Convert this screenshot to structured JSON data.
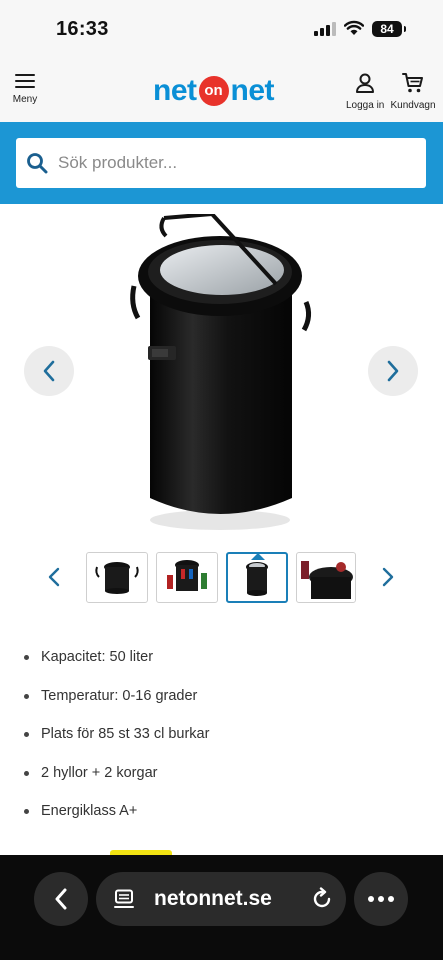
{
  "status_bar": {
    "time": "16:33",
    "battery": "84"
  },
  "header": {
    "menu_label": "Meny",
    "logo": {
      "left": "net",
      "middle": "on",
      "right": "net"
    },
    "login_label": "Logga in",
    "cart_label": "Kundvagn"
  },
  "search": {
    "placeholder": "Sök produkter..."
  },
  "specs": [
    "Kapacitet: 50 liter",
    "Temperatur: 0-16 grader",
    "Plats för 85 st 33 cl burkar",
    "2 hyllor + 2 korgar",
    "Energiklass A+"
  ],
  "browser": {
    "url": "netonnet.se"
  },
  "colors": {
    "brand_blue": "#1c96d4",
    "logo_blue": "#0a8fd6",
    "logo_red": "#e8332b",
    "active_thumb": "#1a7fb8",
    "carousel_arrow": "#1f6e9c"
  },
  "icons": {
    "menu": "hamburger-icon",
    "login": "user-icon",
    "cart": "shopping-cart-icon",
    "search": "search-icon",
    "carousel_prev": "chevron-left-icon",
    "carousel_next": "chevron-right-icon",
    "browser_back": "chevron-left-icon",
    "browser_page": "page-icon",
    "browser_reload": "reload-icon",
    "browser_more": "more-dots-icon"
  },
  "gallery": {
    "thumbnail_count": 4,
    "active_index": 3
  }
}
